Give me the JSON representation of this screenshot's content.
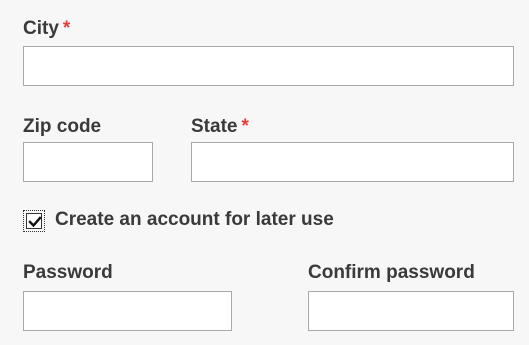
{
  "form": {
    "city": {
      "label": "City",
      "required_mark": "*",
      "value": ""
    },
    "zip": {
      "label": "Zip code",
      "value": ""
    },
    "state": {
      "label": "State",
      "required_mark": "*",
      "value": ""
    },
    "create_account": {
      "label": "Create an account for later use",
      "checked": true
    },
    "password": {
      "label": "Password",
      "value": ""
    },
    "confirm_password": {
      "label": "Confirm password",
      "value": ""
    }
  },
  "colors": {
    "background": "#f7f7f7",
    "label": "#3a3a3a",
    "required": "#e83b3b",
    "input_border": "#a9a9a9"
  },
  "icons": {
    "checkbox_check": "checkmark-icon"
  }
}
